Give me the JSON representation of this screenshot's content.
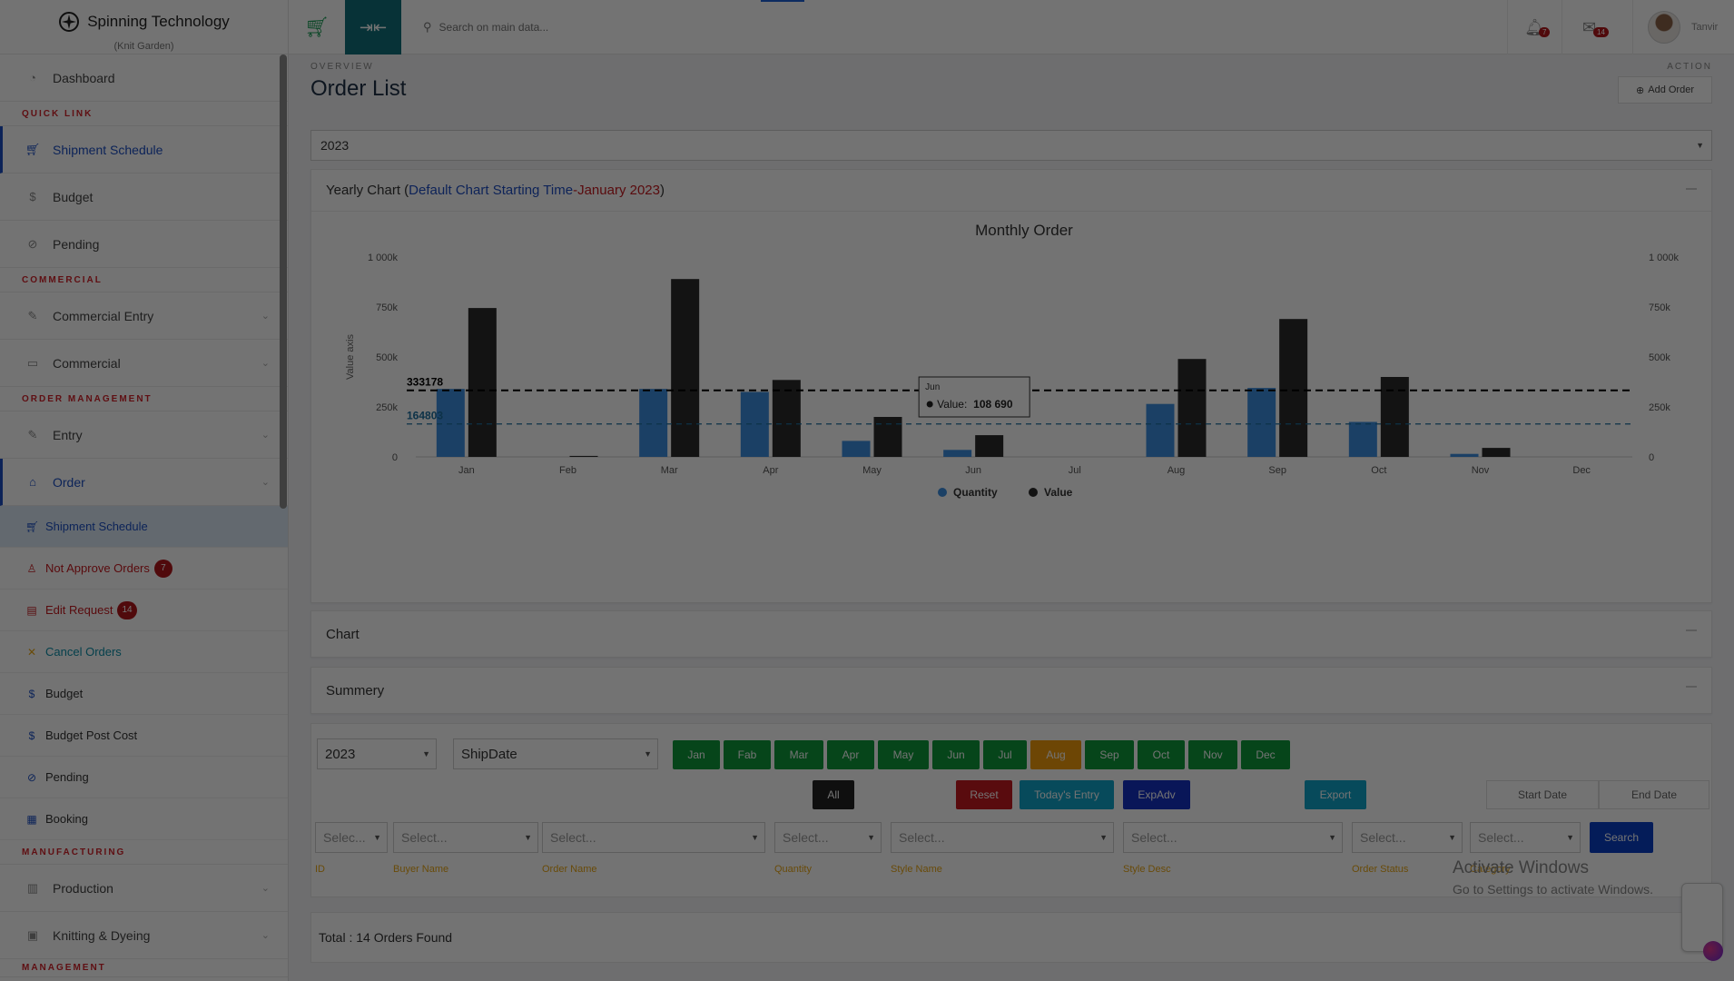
{
  "app": {
    "brand_title": "Spinning Technology",
    "brand_sub": "(Knit Garden)"
  },
  "sidebar": {
    "dashboard": "Dashboard",
    "sections": {
      "quick_link": "QUICK LINK",
      "commercial": "COMMERCIAL",
      "order_management": "ORDER MANAGEMENT",
      "manufacturing": "MANUFACTURING",
      "management": "MANAGEMENT"
    },
    "quick": [
      "Shipment Schedule",
      "Budget",
      "Pending"
    ],
    "commercial": [
      "Commercial Entry",
      "Commercial"
    ],
    "order_mgmt": [
      "Entry",
      "Order"
    ],
    "order_sub": [
      {
        "label": "Shipment Schedule",
        "color": "#1c4fc4"
      },
      {
        "label": "Not Approve Orders",
        "color": "#c6191f",
        "badge": "7"
      },
      {
        "label": "Edit Request",
        "color": "#c6191f",
        "badge": "14"
      },
      {
        "label": "Cancel Orders",
        "color": "#0d8fa8"
      },
      {
        "label": "Budget",
        "color": "#1c4fc4"
      },
      {
        "label": "Budget Post Cost",
        "color": "#1c4fc4"
      },
      {
        "label": "Pending",
        "color": "#1c4fc4"
      },
      {
        "label": "Booking",
        "color": "#1c4fc4"
      }
    ],
    "manufacturing": [
      "Production",
      "Knitting & Dyeing"
    ]
  },
  "topbar": {
    "search_placeholder": "Search on main data...",
    "notif_badge": "7",
    "msg_badge": "14",
    "user_name": "Tanvir"
  },
  "page": {
    "overview_label": "OVERVIEW",
    "action_label": "ACTION",
    "title": "Order List",
    "add_order": "Add Order",
    "year": "2023"
  },
  "yearly_chart": {
    "header_prefix": "Yearly Chart (",
    "header_blue": "Default Chart Starting Time",
    "header_dash": " - ",
    "header_red": "January 2023",
    "header_suffix": ")"
  },
  "chart_data": {
    "type": "bar",
    "title": "Monthly Order",
    "ylabel": "Value axis",
    "categories": [
      "Jan",
      "Feb",
      "Mar",
      "Apr",
      "May",
      "Jun",
      "Jul",
      "Aug",
      "Sep",
      "Oct",
      "Nov",
      "Dec"
    ],
    "series": [
      {
        "name": "Quantity",
        "color": "#3d8fe0",
        "values": [
          340000,
          0,
          340000,
          325000,
          80000,
          35000,
          0,
          265000,
          345000,
          175000,
          15000,
          0
        ]
      },
      {
        "name": "Value",
        "color": "#2a2a2a",
        "values": [
          745000,
          5000,
          890000,
          385000,
          200000,
          108690,
          0,
          490000,
          690000,
          400000,
          45000,
          0
        ]
      }
    ],
    "ylim": [
      0,
      1000000
    ],
    "yticks": [
      "0",
      "250k",
      "500k",
      "750k",
      "1 000k"
    ],
    "reference_lines": [
      {
        "label": "333178",
        "value": 333178,
        "color": "#000000"
      },
      {
        "label": "164803",
        "value": 164803,
        "color": "#1e6f9f"
      }
    ],
    "tooltip": {
      "category": "Jun",
      "label": "Value:",
      "value": "108 690"
    },
    "legend": "bottom"
  },
  "panels": {
    "chart": "Chart",
    "summary": "Summery"
  },
  "filters": {
    "year": "2023",
    "date_type": "ShipDate",
    "months": [
      "Jan",
      "Fab",
      "Mar",
      "Apr",
      "May",
      "Jun",
      "Jul",
      "Aug",
      "Sep",
      "Oct",
      "Nov",
      "Dec"
    ],
    "all": "All",
    "reset": "Reset",
    "todays_entry": "Today's Entry",
    "expadv": "ExpAdv",
    "export": "Export",
    "start_date": "Start Date",
    "end_date": "End Date",
    "selects": [
      "Selec...",
      "Select...",
      "Select...",
      "Select...",
      "Select...",
      "Select...",
      "Select...",
      "Select..."
    ],
    "labels": [
      "ID",
      "Buyer Name",
      "Order Name",
      "Quantity",
      "Style Name",
      "Style Desc",
      "Order Status",
      "Category"
    ],
    "search": "Search"
  },
  "total": "Total : 14 Orders Found",
  "watermark": {
    "line1": "Activate Windows",
    "line2": "Go to Settings to activate Windows."
  }
}
